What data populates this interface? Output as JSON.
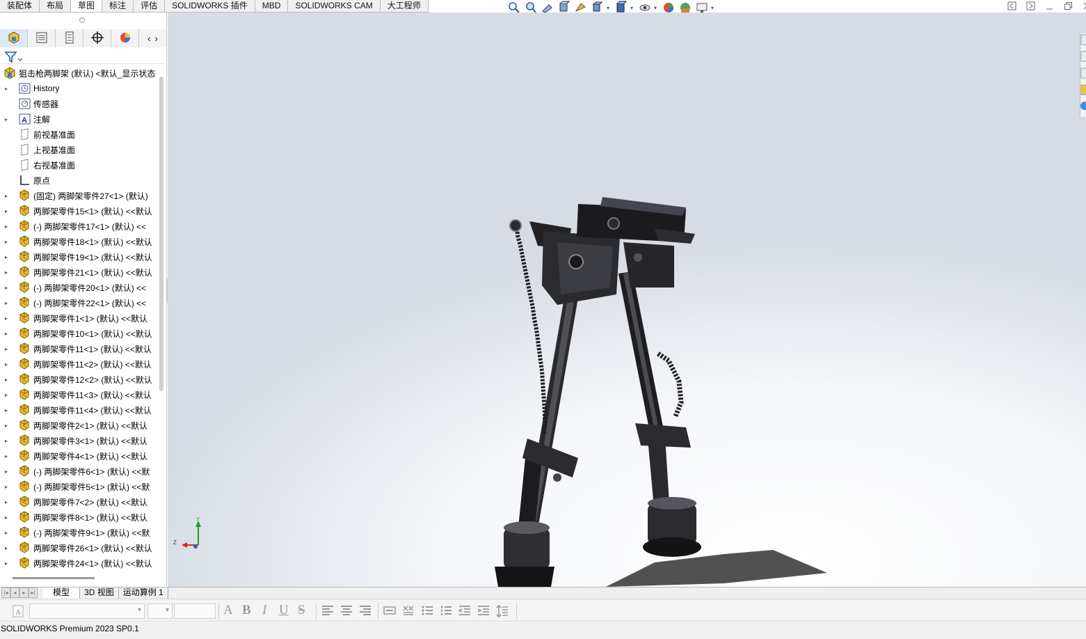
{
  "command_tabs": [
    "装配体",
    "布局",
    "草图",
    "标注",
    "评估",
    "SOLIDWORKS 插件",
    "MBD",
    "SOLIDWORKS CAM",
    "大工程师"
  ],
  "active_command_tab": 2,
  "hud_icons": [
    "zoom-to-fit-icon",
    "zoom-area-icon",
    "previous-view-icon",
    "section-view-icon",
    "dynamic-annotation-icon",
    "view-orientation-icon",
    "display-style-icon",
    "hide-show-icon",
    "edit-appearance-icon",
    "apply-scene-icon",
    "view-settings-icon"
  ],
  "panel_tabs": [
    "feature-manager-icon",
    "property-manager-icon",
    "configuration-manager-icon",
    "dimxpert-icon",
    "display-manager-icon"
  ],
  "tree": {
    "root": "狙击枪两脚架 (默认) <默认_显示状态",
    "items": [
      {
        "label": "History",
        "icon": "history-icon",
        "expandable": true
      },
      {
        "label": "传感器",
        "icon": "sensor-icon",
        "expandable": false
      },
      {
        "label": "注解",
        "icon": "annotation-icon",
        "expandable": true
      },
      {
        "label": "前视基准面",
        "icon": "plane-icon",
        "expandable": false
      },
      {
        "label": "上视基准面",
        "icon": "plane-icon",
        "expandable": false
      },
      {
        "label": "右视基准面",
        "icon": "plane-icon",
        "expandable": false
      },
      {
        "label": "原点",
        "icon": "origin-icon",
        "expandable": false
      },
      {
        "label": "(固定) 两脚架零件27<1> (默认)",
        "icon": "part-icon",
        "expandable": true
      },
      {
        "label": "两脚架零件15<1> (默认) <<默认",
        "icon": "part-icon",
        "expandable": true
      },
      {
        "label": "(-) 两脚架零件17<1> (默认) <<",
        "icon": "part-icon",
        "expandable": true
      },
      {
        "label": "两脚架零件18<1> (默认) <<默认",
        "icon": "part-icon",
        "expandable": true
      },
      {
        "label": "两脚架零件19<1> (默认) <<默认",
        "icon": "part-icon",
        "expandable": true
      },
      {
        "label": "两脚架零件21<1> (默认) <<默认",
        "icon": "part-icon",
        "expandable": true
      },
      {
        "label": "(-) 两脚架零件20<1> (默认) <<",
        "icon": "part-icon",
        "expandable": true
      },
      {
        "label": "(-) 两脚架零件22<1> (默认) <<",
        "icon": "part-icon",
        "expandable": true
      },
      {
        "label": "两脚架零件1<1> (默认) <<默认",
        "icon": "part-icon",
        "expandable": true
      },
      {
        "label": "两脚架零件10<1> (默认) <<默认",
        "icon": "part-icon",
        "expandable": true
      },
      {
        "label": "两脚架零件11<1> (默认) <<默认",
        "icon": "part-icon",
        "expandable": true
      },
      {
        "label": "两脚架零件11<2> (默认) <<默认",
        "icon": "part-icon",
        "expandable": true
      },
      {
        "label": "两脚架零件12<2> (默认) <<默认",
        "icon": "part-icon",
        "expandable": true
      },
      {
        "label": "两脚架零件11<3> (默认) <<默认",
        "icon": "part-icon",
        "expandable": true
      },
      {
        "label": "两脚架零件11<4> (默认) <<默认",
        "icon": "part-icon",
        "expandable": true
      },
      {
        "label": "两脚架零件2<1> (默认) <<默认",
        "icon": "part-icon",
        "expandable": true
      },
      {
        "label": "两脚架零件3<1> (默认) <<默认",
        "icon": "part-icon",
        "expandable": true
      },
      {
        "label": "两脚架零件4<1> (默认) <<默认",
        "icon": "part-icon",
        "expandable": true
      },
      {
        "label": "(-) 两脚架零件6<1> (默认) <<默",
        "icon": "part-icon",
        "expandable": true
      },
      {
        "label": "(-) 两脚架零件5<1> (默认) <<默",
        "icon": "part-icon",
        "expandable": true
      },
      {
        "label": "两脚架零件7<2> (默认) <<默认",
        "icon": "part-icon",
        "expandable": true
      },
      {
        "label": "两脚架零件8<1> (默认) <<默认",
        "icon": "part-icon",
        "expandable": true
      },
      {
        "label": "(-) 两脚架零件9<1> (默认) <<默",
        "icon": "part-icon",
        "expandable": true
      },
      {
        "label": "两脚架零件26<1> (默认) <<默认",
        "icon": "part-icon",
        "expandable": true
      },
      {
        "label": "两脚架零件24<1> (默认) <<默认",
        "icon": "part-icon",
        "expandable": true
      }
    ]
  },
  "bottom_tabs": [
    "模型",
    "3D 视图",
    "运动算例 1"
  ],
  "active_bottom_tab": 0,
  "triad": {
    "y": "Y",
    "z": "Z"
  },
  "format_toolbar": {
    "letters": [
      "A",
      "B",
      "I",
      "U",
      "S"
    ]
  },
  "status_text": "SOLIDWORKS Premium 2023 SP0.1",
  "colors": {
    "accent": "#2a6fd6",
    "part_icon": "#e8b21c",
    "viewport_bg": "#dfe3ea"
  }
}
